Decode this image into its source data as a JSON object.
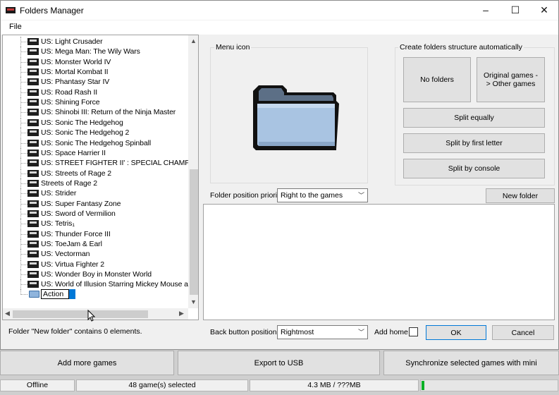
{
  "window": {
    "title": "Folders Manager",
    "minimize": "–",
    "maximize": "☐",
    "close": "✕"
  },
  "menu": {
    "file": "File"
  },
  "tree": {
    "items": [
      "US: Light Crusader",
      "US: Mega Man: The Wily Wars",
      "US: Monster World IV",
      "US: Mortal Kombat II",
      "US: Phantasy Star IV",
      "US: Road Rash II",
      "US: Shining Force",
      "US: Shinobi III: Return of the Ninja Master",
      "US: Sonic The Hedgehog",
      "US: Sonic The Hedgehog 2",
      "US: Sonic The Hedgehog Spinball",
      "US: Space Harrier II",
      "US: STREET FIGHTER II' : SPECIAL CHAMPIO",
      "US: Streets of Rage 2",
      "Streets of Rage 2",
      "US: Strider",
      "US: Super Fantasy Zone",
      "US: Sword of Vermilion",
      "US: Tetris₁",
      "US: Thunder Force III",
      "US: ToeJam & Earl",
      "US: Vectorman",
      "US: Virtua Fighter 2",
      "US: Wonder Boy in Monster World",
      "US: World of Illusion Starring Mickey Mouse and"
    ],
    "edit_value": "Action"
  },
  "menu_icon": {
    "label": "Menu icon",
    "icon": "folder-icon"
  },
  "auto_structure": {
    "label": "Create folders structure automatically",
    "no_folders": "No folders",
    "original_games": "Original games -> Other games",
    "split_equally": "Split equally",
    "split_by_letter": "Split by first letter",
    "split_by_console": "Split by console"
  },
  "folder_position": {
    "label": "Folder position priority:",
    "value": "Right to the games"
  },
  "new_folder": "New folder",
  "status_left": "Folder \"New folder\" contains 0 elements.",
  "back_button": {
    "label": "Back button position:",
    "value": "Rightmost"
  },
  "add_home": "Add home",
  "ok": "OK",
  "cancel": "Cancel",
  "bottom": {
    "add_games": "Add more games",
    "export": "Export to USB",
    "sync": "Synchronize selected games with mini"
  },
  "statusbar": {
    "mode": "Offline",
    "selected": "48 game(s) selected",
    "size": "4.3 MB / ???MB",
    "progress": 0.02
  },
  "colors": {
    "accent": "#0078d7",
    "progress": "#06b025",
    "folder_fill": "#a9c4e2"
  }
}
